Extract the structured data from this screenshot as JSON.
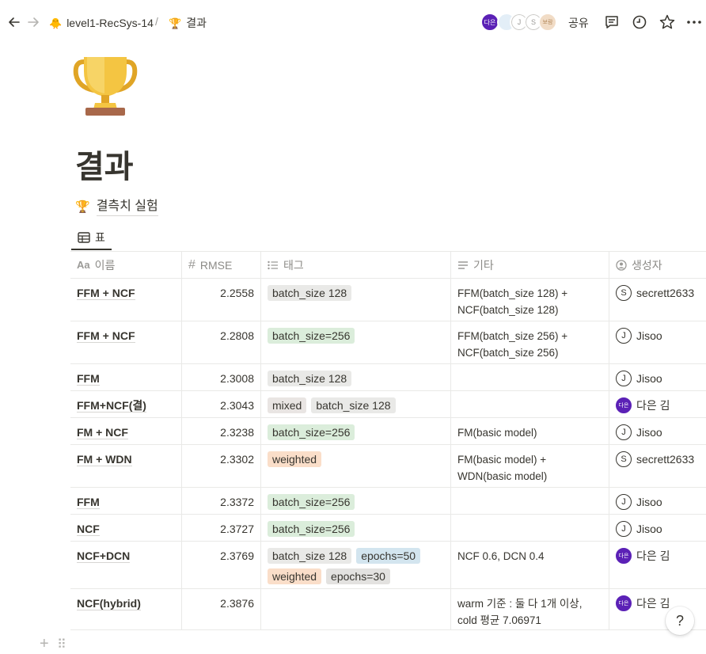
{
  "breadcrumb": {
    "workspace": "level1-RecSys-14",
    "workspace_icon": "chick-emoji",
    "separator": "/",
    "page": "결과",
    "page_icon": "trophy-emoji"
  },
  "topbar": {
    "avatars": [
      "다은",
      "J",
      "S",
      "보람"
    ],
    "share_label": "공유"
  },
  "page": {
    "title": "결과",
    "sub_link": "결측치 실험",
    "view_tab": "표"
  },
  "table": {
    "columns": [
      {
        "icon": "Aa",
        "label": "이름"
      },
      {
        "icon": "#",
        "label": "RMSE"
      },
      {
        "icon": "list-icon",
        "label": "태그"
      },
      {
        "icon": "text-icon",
        "label": "기타"
      },
      {
        "icon": "person-icon",
        "label": "생성자"
      }
    ],
    "rows": [
      {
        "name": "FFM + NCF",
        "rmse": "2.2558",
        "tags": [
          {
            "t": "batch_size 128",
            "c": "#e9e9e7"
          }
        ],
        "etc": "FFM(batch_size 128) +\nNCF(batch_size 128)",
        "user": "secrett2633",
        "av": "S"
      },
      {
        "name": "FFM + NCF",
        "rmse": "2.2808",
        "tags": [
          {
            "t": "batch_size=256",
            "c": "#dbeddb"
          }
        ],
        "etc": "FFM(batch_size 256) +\nNCF(batch_size 256)",
        "user": "Jisoo",
        "av": "J"
      },
      {
        "name": "FFM",
        "rmse": "2.3008",
        "tags": [
          {
            "t": "batch_size 128",
            "c": "#e9e9e7"
          }
        ],
        "etc": "",
        "user": "Jisoo",
        "av": "J"
      },
      {
        "name": "FFM+NCF(결)",
        "rmse": "2.3043",
        "tags": [
          {
            "t": "mixed",
            "c": "#e9e5e3"
          },
          {
            "t": "batch_size 128",
            "c": "#e9e9e7"
          }
        ],
        "etc": "",
        "user": "다은 김",
        "av": "다은"
      },
      {
        "name": "FM + NCF",
        "rmse": "2.3238",
        "tags": [
          {
            "t": "batch_size=256",
            "c": "#dbeddb"
          }
        ],
        "etc": "FM(basic model)",
        "user": "Jisoo",
        "av": "J"
      },
      {
        "name": "FM + WDN",
        "rmse": "2.3302",
        "tags": [
          {
            "t": "weighted",
            "c": "#fadec9"
          }
        ],
        "etc": "FM(basic model) +\nWDN(basic model)",
        "user": "secrett2633",
        "av": "S"
      },
      {
        "name": "FFM",
        "rmse": "2.3372",
        "tags": [
          {
            "t": "batch_size=256",
            "c": "#dbeddb"
          }
        ],
        "etc": "",
        "user": "Jisoo",
        "av": "J"
      },
      {
        "name": "NCF",
        "rmse": "2.3727",
        "tags": [
          {
            "t": "batch_size=256",
            "c": "#dbeddb"
          }
        ],
        "etc": "",
        "user": "Jisoo",
        "av": "J"
      },
      {
        "name": "NCF+DCN",
        "rmse": "2.3769",
        "tags": [
          {
            "t": "batch_size 128",
            "c": "#e9e9e7"
          },
          {
            "t": "epochs=50",
            "c": "#d3e5ef"
          },
          {
            "t": "weighted",
            "c": "#fadec9"
          },
          {
            "t": "epochs=30",
            "c": "#e3e2e0"
          }
        ],
        "etc": "NCF 0.6, DCN 0.4",
        "user": "다은 김",
        "av": "다은"
      },
      {
        "name": "NCF(hybrid)",
        "rmse": "2.3876",
        "tags": [],
        "etc": "warm 기준 : 둘 다 1개 이상,\ncold 평균 7.06971",
        "user": "다은 김",
        "av": "다은"
      }
    ]
  },
  "help_label": "?"
}
